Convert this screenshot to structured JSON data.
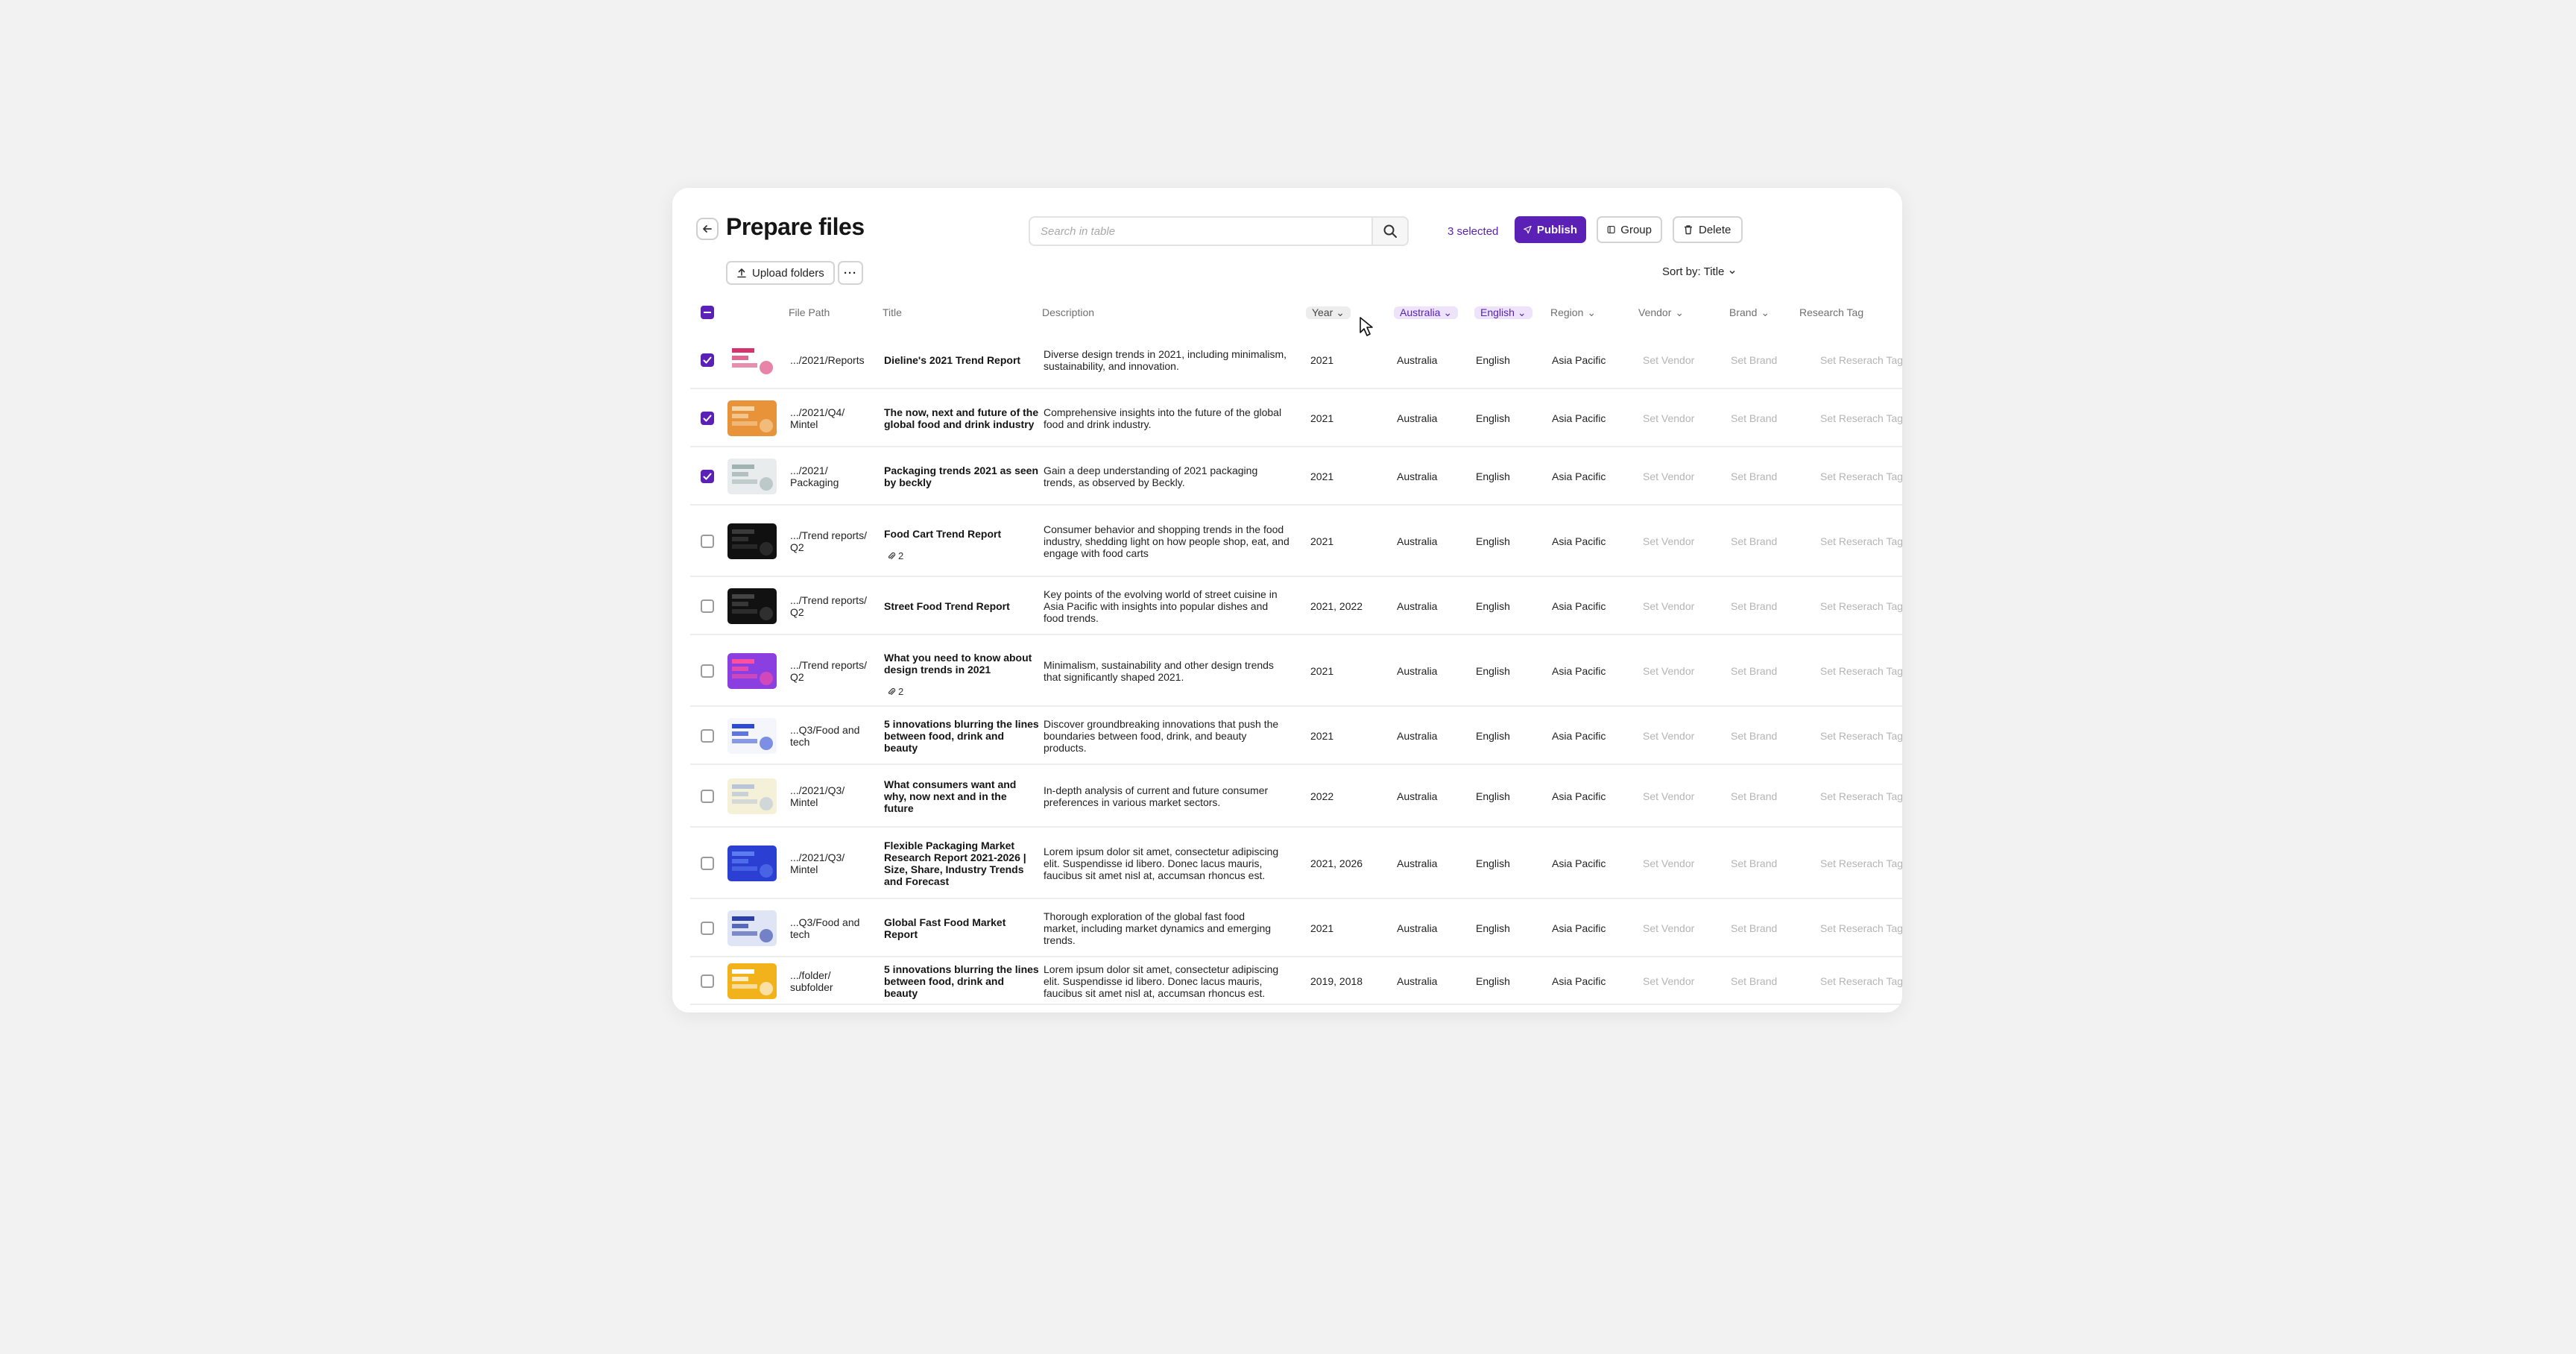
{
  "header": {
    "title": "Prepare files",
    "search_placeholder": "Search in table",
    "selected": "3 selected",
    "publish": "Publish",
    "group": "Group",
    "delete": "Delete",
    "upload": "Upload folders",
    "more": "···",
    "sort": "Sort by: Title"
  },
  "columns": {
    "file_path": "File Path",
    "title": "Title",
    "description": "Description",
    "year": "Year",
    "country": "Australia",
    "language": "English",
    "region": "Region",
    "vendor": "Vendor",
    "brand": "Brand",
    "research_tag": "Research Tag"
  },
  "rows": [
    {
      "checked": true,
      "path": [
        ".../2021/Reports"
      ],
      "title": [
        "Dieline's 2021 Trend Report"
      ],
      "desc": [
        "Diverse design trends in 2021, including minimalism,",
        "sustainability, and innovation."
      ],
      "year": "2021",
      "country": "Australia",
      "language": "English",
      "region": "Asia Pacific",
      "vendor": "Set Vendor",
      "brand": "Set Brand",
      "tag": "Set Reserach Tag",
      "attach": ""
    },
    {
      "checked": true,
      "path": [
        ".../2021/Q4/",
        "Mintel"
      ],
      "title": [
        "The now, next and future of the",
        "global food and drink industry"
      ],
      "desc": [
        "Comprehensive insights into the future of the global",
        "food and drink industry."
      ],
      "year": "2021",
      "country": "Australia",
      "language": "English",
      "region": "Asia Pacific",
      "vendor": "Set Vendor",
      "brand": "Set Brand",
      "tag": "Set Reserach Tag",
      "attach": ""
    },
    {
      "checked": true,
      "path": [
        ".../2021/",
        "Packaging"
      ],
      "title": [
        "Packaging trends 2021 as seen",
        "by beckly"
      ],
      "desc": [
        "Gain a deep understanding of 2021 packaging",
        "trends, as observed by Beckly."
      ],
      "year": "2021",
      "country": "Australia",
      "language": "English",
      "region": "Asia Pacific",
      "vendor": "Set Vendor",
      "brand": "Set Brand",
      "tag": "Set Reserach Tag",
      "attach": ""
    },
    {
      "checked": false,
      "path": [
        ".../Trend reports/",
        "Q2"
      ],
      "title": [
        "Food Cart Trend Report"
      ],
      "desc": [
        "Consumer behavior and shopping trends in the food",
        "industry, shedding light on how people shop, eat, and",
        "engage with food carts"
      ],
      "year": "2021",
      "country": "Australia",
      "language": "English",
      "region": "Asia Pacific",
      "vendor": "Set Vendor",
      "brand": "Set Brand",
      "tag": "Set Reserach Tag",
      "attach": "2"
    },
    {
      "checked": false,
      "path": [
        ".../Trend reports/",
        "Q2"
      ],
      "title": [
        "Street Food Trend Report"
      ],
      "desc": [
        "Key points of the evolving world of street cuisine in",
        "Asia Pacific with insights into popular dishes and",
        "food trends."
      ],
      "year": "2021, 2022",
      "country": "Australia",
      "language": "English",
      "region": "Asia Pacific",
      "vendor": "Set Vendor",
      "brand": "Set Brand",
      "tag": "Set Reserach Tag",
      "attach": ""
    },
    {
      "checked": false,
      "path": [
        ".../Trend reports/",
        "Q2"
      ],
      "title": [
        "What you need to know about",
        "design trends in 2021"
      ],
      "desc": [
        "Minimalism, sustainability and other design trends",
        "that significantly shaped 2021."
      ],
      "year": "2021",
      "country": "Australia",
      "language": "English",
      "region": "Asia Pacific",
      "vendor": "Set Vendor",
      "brand": "Set Brand",
      "tag": "Set Reserach Tag",
      "attach": "2"
    },
    {
      "checked": false,
      "path": [
        "...Q3/Food and",
        "tech"
      ],
      "title": [
        "5 innovations blurring the lines",
        "between food, drink and",
        "beauty"
      ],
      "desc": [
        "Discover groundbreaking innovations that push the",
        "boundaries between food, drink, and beauty",
        "products."
      ],
      "year": "2021",
      "country": "Australia",
      "language": "English",
      "region": "Asia Pacific",
      "vendor": "Set Vendor",
      "brand": "Set Brand",
      "tag": "Set Reserach Tag",
      "attach": ""
    },
    {
      "checked": false,
      "path": [
        ".../2021/Q3/",
        "Mintel"
      ],
      "title": [
        "What consumers want and",
        "why, now next and in the",
        "future"
      ],
      "desc": [
        "In-depth analysis of current and future consumer",
        "preferences in various market sectors."
      ],
      "year": "2022",
      "country": "Australia",
      "language": "English",
      "region": "Asia Pacific",
      "vendor": "Set Vendor",
      "brand": "Set Brand",
      "tag": "Set Reserach Tag",
      "attach": ""
    },
    {
      "checked": false,
      "path": [
        ".../2021/Q3/",
        "Mintel"
      ],
      "title": [
        "Flexible Packaging Market",
        "Research Report 2021-2026 |",
        "Size, Share, Industry Trends",
        "and Forecast"
      ],
      "desc": [
        "Lorem ipsum dolor sit amet, consectetur adipiscing",
        "elit. Suspendisse id libero. Donec lacus mauris,",
        "faucibus sit amet nisl at, accumsan rhoncus est."
      ],
      "year": "2021, 2026",
      "country": "Australia",
      "language": "English",
      "region": "Asia Pacific",
      "vendor": "Set Vendor",
      "brand": "Set Brand",
      "tag": "Set Reserach Tag",
      "attach": ""
    },
    {
      "checked": false,
      "path": [
        "...Q3/Food and",
        "tech"
      ],
      "title": [
        "Global Fast Food Market",
        "Report"
      ],
      "desc": [
        "Thorough exploration of the global fast food",
        "market, including market dynamics and emerging",
        "trends."
      ],
      "year": "2021",
      "country": "Australia",
      "language": "English",
      "region": "Asia Pacific",
      "vendor": "Set Vendor",
      "brand": "Set Brand",
      "tag": "Set Reserach Tag",
      "attach": ""
    },
    {
      "checked": false,
      "path": [
        ".../folder/",
        "subfolder"
      ],
      "title": [
        "5 innovations blurring the lines",
        "between food, drink and",
        "beauty"
      ],
      "desc": [
        "Lorem ipsum dolor sit amet, consectetur adipiscing",
        "elit. Suspendisse id libero. Donec lacus mauris,",
        "faucibus sit amet nisl at, accumsan rhoncus est."
      ],
      "year": "2019, 2018",
      "country": "Australia",
      "language": "English",
      "region": "Asia Pacific",
      "vendor": "Set Vendor",
      "brand": "Set Brand",
      "tag": "Set Reserach Tag",
      "attach": ""
    }
  ],
  "thumbnails": [
    {
      "icon": "dieline-cover-thumbnail",
      "bg": "#ffffff",
      "accent": "#d6336c"
    },
    {
      "icon": "food-photo-thumbnail",
      "bg": "#e8933a",
      "accent": "#f6d6a8"
    },
    {
      "icon": "packaging-cover-thumbnail",
      "bg": "#e9ecec",
      "accent": "#9fb3b0"
    },
    {
      "icon": "dark-cover-thumbnail",
      "bg": "#101010",
      "accent": "#3a3a3a"
    },
    {
      "icon": "dark-cover-thumbnail",
      "bg": "#111111",
      "accent": "#444444"
    },
    {
      "icon": "design-trends-cover-thumbnail",
      "bg": "#8b3fe0",
      "accent": "#ff4fa0"
    },
    {
      "icon": "innovation-cover-thumbnail",
      "bg": "#f4f6fb",
      "accent": "#2c4bd6"
    },
    {
      "icon": "consumer-cover-thumbnail",
      "bg": "#f5f0d8",
      "accent": "#b8c6d8"
    },
    {
      "icon": "blue-cover-thumbnail",
      "bg": "#2b3fd2",
      "accent": "#5b7cf0"
    },
    {
      "icon": "chart-cover-thumbnail",
      "bg": "#dfe5f4",
      "accent": "#2b3fa8"
    },
    {
      "icon": "yellow-cover-thumbnail",
      "bg": "#f2b21c",
      "accent": "#ffffff"
    }
  ]
}
